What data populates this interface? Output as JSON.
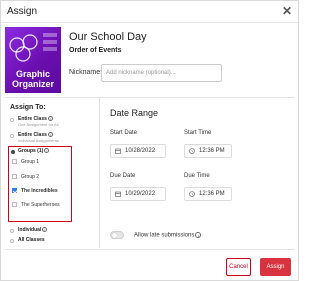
{
  "dialog": {
    "title": "Assign",
    "close_icon": "close-icon"
  },
  "activity": {
    "thumbnail_text_line1": "Graphic",
    "thumbnail_text_line2": "Organizer",
    "title": "Our School Day",
    "subtitle": "Order of Events",
    "nickname_label": "Nickname:",
    "nickname_placeholder": "Add nickname (optional)..."
  },
  "assign_to": {
    "heading": "Assign To:",
    "entire_class_1": {
      "label": "Entire Class",
      "desc": "One Assignment for All"
    },
    "entire_class_2": {
      "label": "Entire Class",
      "desc": "Individual Assignments"
    },
    "groups": {
      "label": "Groups (1)",
      "items": [
        {
          "label": "Group 1",
          "checked": false
        },
        {
          "label": "Group 2",
          "checked": false
        },
        {
          "label": "The Incredibles",
          "checked": true
        },
        {
          "label": "The Superheroes",
          "checked": false
        }
      ]
    },
    "individual": {
      "label": "Individual"
    },
    "all_classes": {
      "label": "All Classes"
    }
  },
  "date_range": {
    "heading": "Date Range",
    "start_date_label": "Start Date",
    "start_date_value": "10/28/2022",
    "start_time_label": "Start Time",
    "start_time_value": "12:36 PM",
    "due_date_label": "Due Date",
    "due_date_value": "10/29/2022",
    "due_time_label": "Due Time",
    "due_time_value": "12:36 PM",
    "late_submissions_label": "Allow late submissions",
    "late_submissions_enabled": false
  },
  "footer": {
    "cancel_label": "Cancel",
    "assign_label": "Assign"
  },
  "colors": {
    "accent_red": "#d9333f",
    "highlight_border": "#d0021b",
    "check_blue": "#2d7ff9",
    "thumbnail_purple": "#7b1fd6"
  }
}
